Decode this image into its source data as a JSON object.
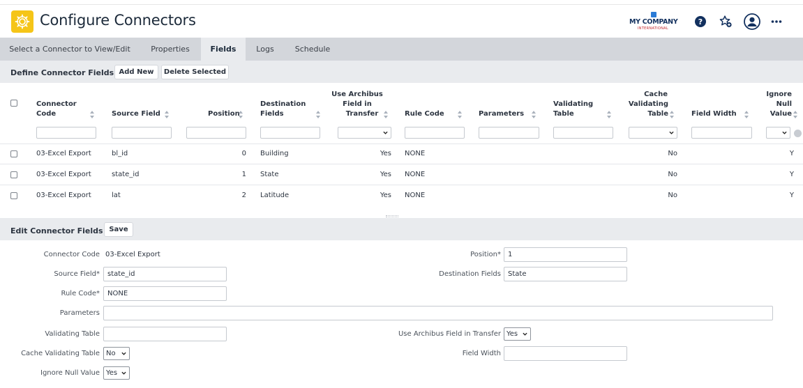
{
  "header": {
    "title": "Configure Connectors",
    "logo_main": "MY COMPANY",
    "logo_sub": "INTERNATIONAL"
  },
  "icons": {
    "app": "gear-icon",
    "help": "help-icon",
    "favorites": "star-add-icon",
    "user": "user-icon",
    "more": "more-icon"
  },
  "colors": {
    "app_icon_bg": "#f5c518",
    "title": "#1c2a3a",
    "tab_bar": "#d3d6db",
    "panel_bar": "#e9ebee",
    "icon_blue": "#12305e"
  },
  "tabs": [
    {
      "label": "Select a Connector to View/Edit",
      "active": false
    },
    {
      "label": "Properties",
      "active": false
    },
    {
      "label": "Fields",
      "active": true
    },
    {
      "label": "Logs",
      "active": false
    },
    {
      "label": "Schedule",
      "active": false
    }
  ],
  "define_panel": {
    "title": "Define Connector Fields",
    "add_new": "Add New",
    "delete_selected": "Delete Selected"
  },
  "grid": {
    "columns": {
      "connector_code": [
        "Connector",
        "Code"
      ],
      "source_field": [
        "Source Field"
      ],
      "position": [
        "Position"
      ],
      "destination_fields": [
        "Destination",
        "Fields"
      ],
      "use_archibus": [
        "Use Archibus",
        "Field in",
        "Transfer"
      ],
      "rule_code": [
        "Rule Code"
      ],
      "parameters": [
        "Parameters"
      ],
      "validating_table": [
        "Validating",
        "Table"
      ],
      "cache_validating": [
        "Cache",
        "Validating",
        "Table"
      ],
      "field_width": [
        "Field Width"
      ],
      "ignore_null": [
        "Ignore",
        "Null",
        "Value"
      ]
    },
    "rows": [
      {
        "connector_code": "03-Excel Export",
        "source_field": "bl_id",
        "position": "0",
        "destination_fields": "Building",
        "use_archibus": "Yes",
        "rule_code": "NONE",
        "cache_validating": "No",
        "ignore_null": "Y"
      },
      {
        "connector_code": "03-Excel Export",
        "source_field": "state_id",
        "position": "1",
        "destination_fields": "State",
        "use_archibus": "Yes",
        "rule_code": "NONE",
        "cache_validating": "No",
        "ignore_null": "Y"
      },
      {
        "connector_code": "03-Excel Export",
        "source_field": "lat",
        "position": "2",
        "destination_fields": "Latitude",
        "use_archibus": "Yes",
        "rule_code": "NONE",
        "cache_validating": "No",
        "ignore_null": "Y"
      }
    ]
  },
  "edit_panel": {
    "title": "Edit Connector Fields",
    "save": "Save"
  },
  "form": {
    "connector_code_label": "Connector Code",
    "connector_code_value": "03-Excel Export",
    "source_field_label": "Source Field*",
    "source_field_value": "state_id",
    "rule_code_label": "Rule Code*",
    "rule_code_value": "NONE",
    "parameters_label": "Parameters",
    "parameters_value": "",
    "validating_table_label": "Validating Table",
    "validating_table_value": "",
    "cache_validating_label": "Cache Validating Table",
    "cache_validating_value": "No",
    "ignore_null_label": "Ignore Null Value",
    "ignore_null_value": "Yes",
    "position_label": "Position*",
    "position_value": "1",
    "destination_label": "Destination Fields",
    "destination_value": "State",
    "use_archibus_label": "Use Archibus Field in Transfer",
    "use_archibus_value": "Yes",
    "field_width_label": "Field Width",
    "field_width_value": ""
  }
}
